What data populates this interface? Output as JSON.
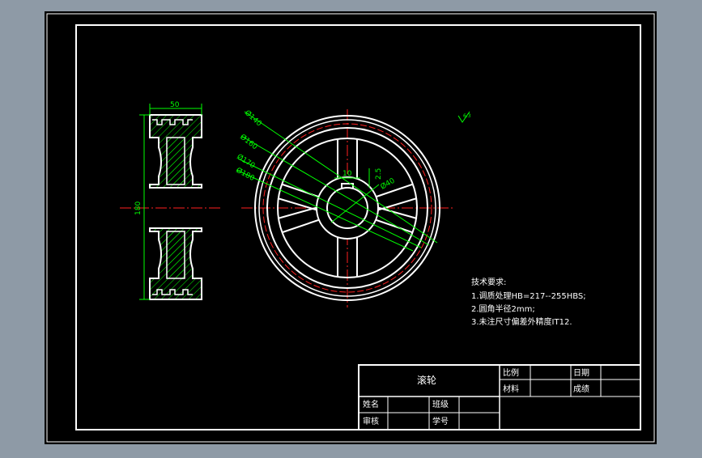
{
  "colors": {
    "frame_bg": "#8e9aa6",
    "paper": "#000000",
    "line": "#ffffff",
    "center": "#ff2020",
    "dim": "#00ff00",
    "hatch": "#00ff00"
  },
  "dimensions": {
    "width_50": "50",
    "height_180": "180",
    "dia_140": "Ø140",
    "dia_160": "Ø160",
    "dia_170": "Ø170",
    "dia_180": "Ø180",
    "dia_40": "Ø40",
    "key_width": "10",
    "key_depth": "2.5"
  },
  "roughness_symbol": "6.3",
  "tech_requirements": {
    "title": "技术要求:",
    "items": [
      "1.调质处理HB=217--255HBS;",
      "2.圆角半径2mm;",
      "3.未注尺寸偏差外精度IT12."
    ]
  },
  "title_block": {
    "part_name": "滚轮",
    "ratio_label": "比例",
    "date_label": "日期",
    "material_label": "材料",
    "score_label": "成绩",
    "name_label": "姓名",
    "class_label": "班级",
    "review_label": "审核",
    "student_id_label": "学号"
  }
}
